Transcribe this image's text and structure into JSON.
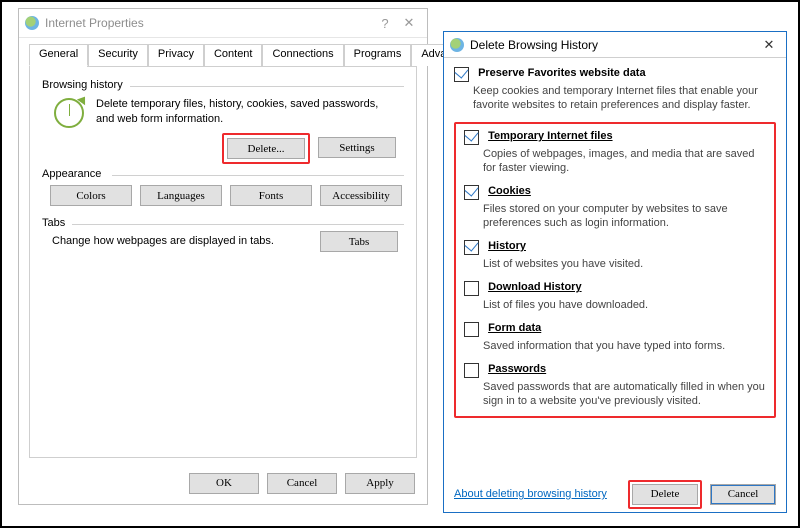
{
  "ip": {
    "title": "Internet Properties",
    "tabs": [
      "General",
      "Security",
      "Privacy",
      "Content",
      "Connections",
      "Programs",
      "Advanced"
    ],
    "groups": {
      "browsing_history": {
        "label": "Browsing history",
        "text": "Delete temporary files, history, cookies, saved passwords, and web form information.",
        "delete_btn": "Delete...",
        "settings_btn": "Settings"
      },
      "appearance": {
        "label": "Appearance",
        "buttons": {
          "colors": "Colors",
          "languages": "Languages",
          "fonts": "Fonts",
          "accessibility": "Accessibility"
        }
      },
      "tabs_group": {
        "label": "Tabs",
        "text": "Change how webpages are displayed in tabs.",
        "tabs_btn": "Tabs"
      }
    },
    "footer": {
      "ok": "OK",
      "cancel": "Cancel",
      "apply": "Apply"
    }
  },
  "dbh": {
    "title": "Delete Browsing History",
    "preserve": {
      "label": "Preserve Favorites website data",
      "desc": "Keep cookies and temporary Internet files that enable your favorite websites to retain preferences and display faster.",
      "checked": true
    },
    "options": [
      {
        "key": "temp",
        "label": "Temporary Internet files",
        "desc": "Copies of webpages, images, and media that are saved for faster viewing.",
        "checked": true
      },
      {
        "key": "cookies",
        "label": "Cookies",
        "desc": "Files stored on your computer by websites to save preferences such as login information.",
        "checked": true
      },
      {
        "key": "history",
        "label": "History",
        "desc": "List of websites you have visited.",
        "checked": true
      },
      {
        "key": "dlhistory",
        "label": "Download History",
        "desc": "List of files you have downloaded.",
        "checked": false
      },
      {
        "key": "formdata",
        "label": "Form data",
        "desc": "Saved information that you have typed into forms.",
        "checked": false
      },
      {
        "key": "passwords",
        "label": "Passwords",
        "desc": "Saved passwords that are automatically filled in when you sign in to a website you've previously visited.",
        "checked": false
      }
    ],
    "about_link": "About deleting browsing history",
    "delete_btn": "Delete",
    "cancel_btn": "Cancel"
  }
}
